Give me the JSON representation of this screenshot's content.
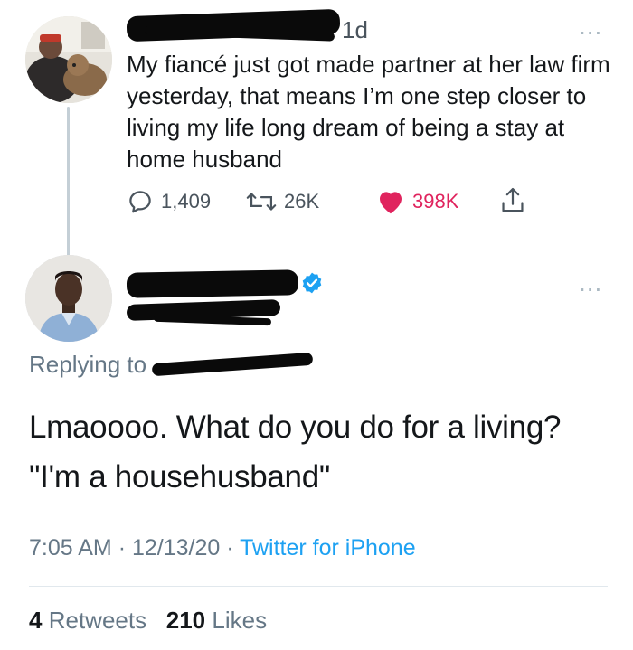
{
  "tweet": {
    "time_ago": "1d",
    "more_label": "...",
    "text": "My fiancé just got made partner at her law firm yesterday, that means I’m one step closer to living my life long dream of being a stay at home husband",
    "actions": {
      "replies": "1,409",
      "retweets": "26K",
      "likes": "398K"
    },
    "icons": {
      "reply": "reply-icon",
      "retweet": "retweet-icon",
      "like": "heart-icon",
      "share": "share-icon"
    },
    "like_color": "#e0245e"
  },
  "reply": {
    "more_label": "...",
    "replying_prefix": "Replying to",
    "text_line1": "Lmaoooo. What do you do for a living?",
    "text_line2": "\"I'm a househusband\"",
    "time": "7:05 AM",
    "separator": "·",
    "date": "12/13/20",
    "client": "Twitter for iPhone",
    "retweet_count": "4",
    "retweet_label": "Retweets",
    "like_count": "210",
    "like_label": "Likes",
    "verified_color": "#1da1f2",
    "link_color": "#1da1f2"
  }
}
